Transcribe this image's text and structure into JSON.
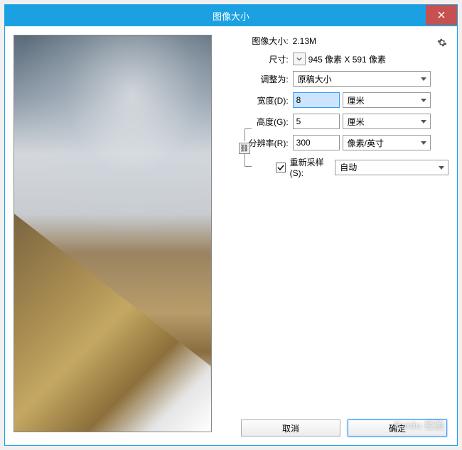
{
  "title": "图像大小",
  "info": {
    "imageSizeLabel": "图像大小:",
    "imageSizeValue": "2.13M",
    "dimensionsLabel": "尺寸:",
    "dimensionsValue": "945 像素  X  591 像素",
    "fitToLabel": "调整为:",
    "fitToValue": "原稿大小"
  },
  "width": {
    "label": "宽度(D):",
    "value": "8",
    "unit": "厘米"
  },
  "height": {
    "label": "高度(G):",
    "value": "5",
    "unit": "厘米"
  },
  "resolution": {
    "label": "分辨率(R):",
    "value": "300",
    "unit": "像素/英寸"
  },
  "resample": {
    "label": "重新采样(S):",
    "value": "自动",
    "checked": true
  },
  "buttons": {
    "cancel": "取消",
    "ok": "确定"
  },
  "watermark": "Baidu 经验"
}
